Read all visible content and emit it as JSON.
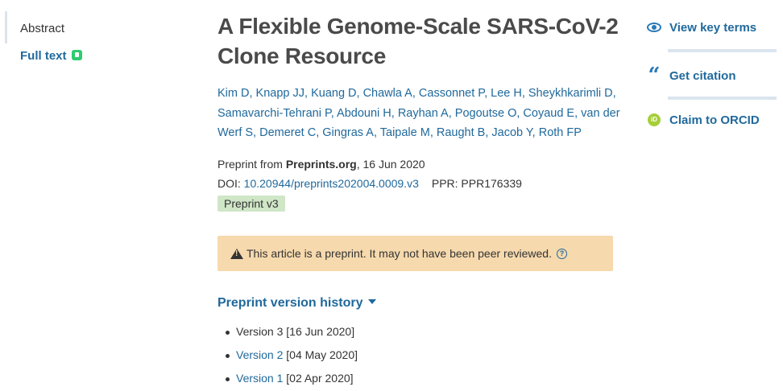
{
  "sidebar": {
    "items": [
      {
        "label": "Abstract"
      },
      {
        "label": "Full text"
      }
    ]
  },
  "article": {
    "title": "A Flexible Genome-Scale SARS-CoV-2 Clone Resource",
    "authors": [
      "Kim D",
      "Knapp JJ",
      "Kuang D",
      "Chawla A",
      "Cassonnet P",
      "Lee H",
      "Sheykhkarimli D",
      "Samavarchi-Tehrani P",
      "Abdouni H",
      "Rayhan A",
      "Pogoutse O",
      "Coyaud E",
      "van der Werf S",
      "Demeret C",
      "Gingras A",
      "Taipale M",
      "Raught B",
      "Jacob Y",
      "Roth FP"
    ],
    "source_prefix": "Preprint from ",
    "source_name": "Preprints.org",
    "source_date": ", 16 Jun 2020",
    "doi_label": "DOI: ",
    "doi_value": "10.20944/preprints202004.0009.v3",
    "ppr_label": "PPR: PPR176339",
    "badge": "Preprint v3"
  },
  "notice": {
    "text": "This article is a preprint. It may not have been peer reviewed.",
    "help_icon": "?"
  },
  "history": {
    "title": "Preprint version history",
    "versions": [
      {
        "link": "",
        "prefix": "Version 3",
        "date": " [16 Jun 2020]"
      },
      {
        "link": "Version 2",
        "prefix": "",
        "date": " [04 May 2020]"
      },
      {
        "link": "Version 1",
        "prefix": "",
        "date": " [02 Apr 2020]"
      }
    ]
  },
  "actions": {
    "view_key_terms": "View key terms",
    "get_citation": "Get citation",
    "claim_orcid": "Claim to ORCID",
    "orcid_glyph": "iD"
  },
  "colors": {
    "link": "#20699c",
    "notice_bg": "#f6d9ad",
    "badge_bg": "#cfe6c7",
    "orcid": "#a6ce39"
  }
}
